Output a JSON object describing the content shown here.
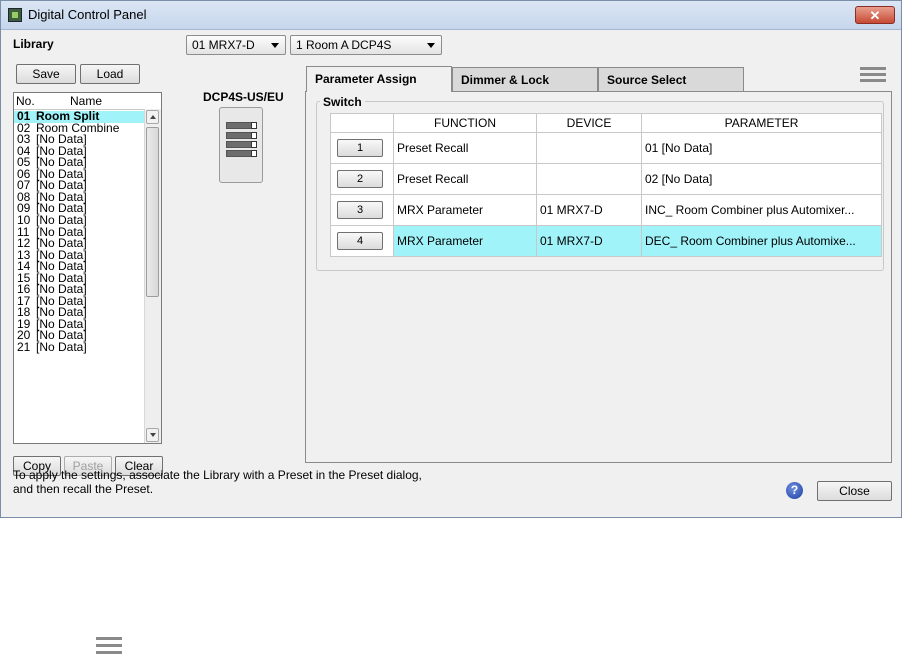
{
  "window": {
    "title": "Digital Control Panel",
    "close_glyph": "✕"
  },
  "library": {
    "label": "Library",
    "save_label": "Save",
    "load_label": "Load",
    "col_no": "No.",
    "col_name": "Name",
    "items": [
      {
        "no": "01",
        "name": "Room Split"
      },
      {
        "no": "02",
        "name": "Room Combine"
      },
      {
        "no": "03",
        "name": "[No Data]"
      },
      {
        "no": "04",
        "name": "[No Data]"
      },
      {
        "no": "05",
        "name": "[No Data]"
      },
      {
        "no": "06",
        "name": "[No Data]"
      },
      {
        "no": "07",
        "name": "[No Data]"
      },
      {
        "no": "08",
        "name": "[No Data]"
      },
      {
        "no": "09",
        "name": "[No Data]"
      },
      {
        "no": "10",
        "name": "[No Data]"
      },
      {
        "no": "11",
        "name": "[No Data]"
      },
      {
        "no": "12",
        "name": "[No Data]"
      },
      {
        "no": "13",
        "name": "[No Data]"
      },
      {
        "no": "14",
        "name": "[No Data]"
      },
      {
        "no": "15",
        "name": "[No Data]"
      },
      {
        "no": "16",
        "name": "[No Data]"
      },
      {
        "no": "17",
        "name": "[No Data]"
      },
      {
        "no": "18",
        "name": "[No Data]"
      },
      {
        "no": "19",
        "name": "[No Data]"
      },
      {
        "no": "20",
        "name": "[No Data]"
      },
      {
        "no": "21",
        "name": "[No Data]"
      }
    ],
    "copy_label": "Copy",
    "paste_label": "Paste",
    "clear_label": "Clear"
  },
  "device_select": "01 MRX7-D",
  "panel_select": "1 Room A DCP4S",
  "device_model": "DCP4S-US/EU",
  "tabs": [
    "Parameter Assign",
    "Dimmer & Lock",
    "Source Select"
  ],
  "switch_group_label": "Switch",
  "table": {
    "headers": [
      "FUNCTION",
      "DEVICE",
      "PARAMETER"
    ],
    "rows": [
      {
        "num": "1",
        "function": "Preset Recall",
        "device": "",
        "parameter": "01 [No Data]"
      },
      {
        "num": "2",
        "function": "Preset Recall",
        "device": "",
        "parameter": "02 [No Data]"
      },
      {
        "num": "3",
        "function": "MRX Parameter",
        "device": "01 MRX7-D",
        "parameter": "INC_ Room Combiner plus Automixer..."
      },
      {
        "num": "4",
        "function": "MRX Parameter",
        "device": "01 MRX7-D",
        "parameter": "DEC_ Room Combiner plus Automixe..."
      }
    ]
  },
  "footnote_line1": "To apply the settings, associate the Library with a Preset in the Preset dialog,",
  "footnote_line2": "and then recall the Preset.",
  "help_glyph": "?",
  "close_label": "Close"
}
